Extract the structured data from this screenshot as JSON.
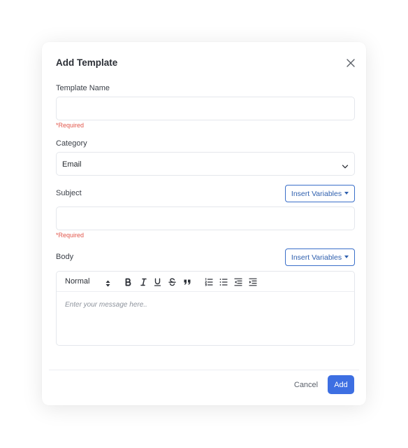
{
  "modal": {
    "title": "Add Template",
    "close_icon": "close-icon"
  },
  "template_name": {
    "label": "Template Name",
    "value": "",
    "placeholder": "",
    "required_text": "*Required"
  },
  "category": {
    "label": "Category",
    "selected": "Email",
    "icon": "chevron-down-icon"
  },
  "subject": {
    "label": "Subject",
    "insert_variables_label": "Insert Variables",
    "value": "",
    "placeholder": "",
    "required_text": "*Required"
  },
  "body": {
    "label": "Body",
    "insert_variables_label": "Insert Variables",
    "toolbar": {
      "heading_select": "Normal",
      "buttons": [
        "bold-icon",
        "italic-icon",
        "underline-icon",
        "strikethrough-icon",
        "blockquote-icon",
        "ordered-list-icon",
        "bullet-list-icon",
        "outdent-icon",
        "indent-icon"
      ]
    },
    "placeholder": "Enter your message here.."
  },
  "footer": {
    "cancel_label": "Cancel",
    "add_label": "Add"
  },
  "colors": {
    "accent": "#3d6fe2",
    "required": "#e2574c",
    "outline_button": "#3a6fc9"
  }
}
